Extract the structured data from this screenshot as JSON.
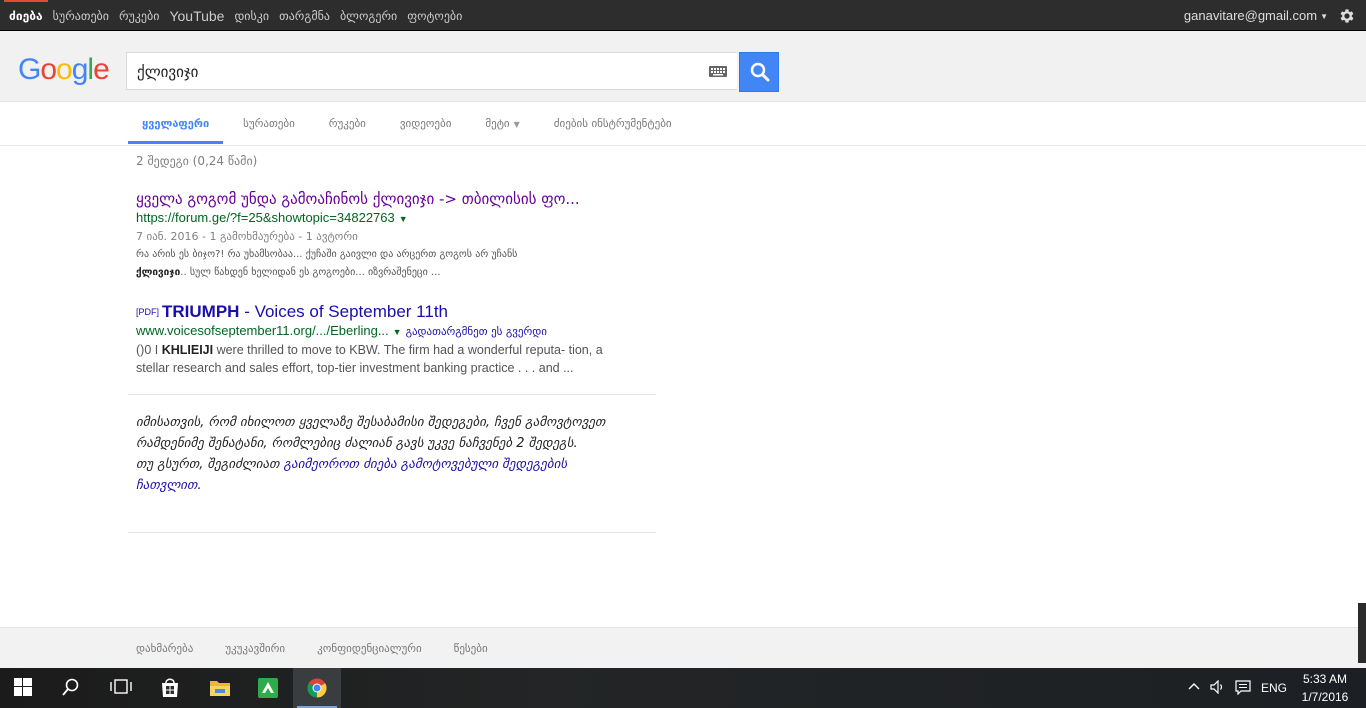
{
  "gbar": {
    "apps": [
      "ძიება",
      "სურათები",
      "რუკები",
      "YouTube",
      "დისკი",
      "თარგმნა",
      "ბლოგერი",
      "ფოტოები"
    ],
    "account": "ganavitare@gmail.com",
    "settings_icon": "gear-icon"
  },
  "header": {
    "logo_letters": [
      {
        "ch": "G",
        "color": "#4285f4"
      },
      {
        "ch": "o",
        "color": "#ea4335"
      },
      {
        "ch": "o",
        "color": "#fbbc05"
      },
      {
        "ch": "g",
        "color": "#4285f4"
      },
      {
        "ch": "l",
        "color": "#34a853"
      },
      {
        "ch": "e",
        "color": "#ea4335"
      }
    ],
    "query": "ქლივიჯი",
    "keyboard_icon": "keyboard-icon",
    "search_icon": "search-icon"
  },
  "tabs": [
    {
      "label": "ყველაფერი",
      "active": true
    },
    {
      "label": "სურათები",
      "active": false
    },
    {
      "label": "რუკები",
      "active": false
    },
    {
      "label": "ვიდეოები",
      "active": false
    },
    {
      "label": "მეტი",
      "active": false
    },
    {
      "label": "ძიების ინსტრუმენტები",
      "active": false
    }
  ],
  "stats": "2 შედეგი (0,24 წამი)",
  "results": [
    {
      "title": "ყველა გოგომ უნდა გამოაჩინოს ქლივიჯი -> თბილისის ფო...",
      "url": "https://forum.ge/?f=25&showtopic=34822763",
      "meta": "7 იან. 2016 - 1 გამოხმაურება - 1 ავტორი",
      "snippet_line1": "რა არის ეს ბიჯო?! რა უხამსობაა... ქუჩაში გაივლი და არცერთ გოგოს არ უჩანს",
      "snippet_bold": "ქლივიჯი",
      "snippet_line2": ".. სულ წახდენ ხელიდან ეს გოგოები... იზვრაშენეცი ..."
    },
    {
      "pdf_tag": "[PDF]",
      "title_bold": "TRIUMPH",
      "title_rest": " - Voices of September 11th",
      "url": "www.voicesofseptember11.org/.../Eberling...",
      "translate": "გადათარგმნეთ ეს გვერდი",
      "snippet_pre": "()0 I ",
      "snippet_bold": "KHLIEIJI",
      "snippet_line1": " were thrilled to move to KBW. The firm had a wonderful reputa- tion, a",
      "snippet_line2": "stellar research and sales effort, top-tier investment banking practice . . . and ..."
    }
  ],
  "omitted": {
    "text": "იმისათვის, რომ იხილოთ ყველაზე შესაბამისი შედეგები, ჩვენ გამოვტოვეთ რამდენიმე შენატანი, რომლებიც ძალიან გავს უკვე ნაჩვენებ 2 შედეგს.",
    "line2_pre": "თუ გსურთ, შეგიძლიათ ",
    "link": "გაიმეოროთ ძიება გამოტოვებული შედეგების ჩათვლით."
  },
  "footer": [
    "დახმარება",
    "უკუკავშირი",
    "კონფიდენციალური",
    "წესები"
  ],
  "taskbar": {
    "icons": [
      "windows-start-icon",
      "search-icon",
      "task-view-icon",
      "store-icon",
      "file-explorer-icon",
      "green-app-icon",
      "chrome-icon"
    ],
    "lang": "ENG",
    "time": "5:33 AM",
    "date": "1/7/2016"
  }
}
